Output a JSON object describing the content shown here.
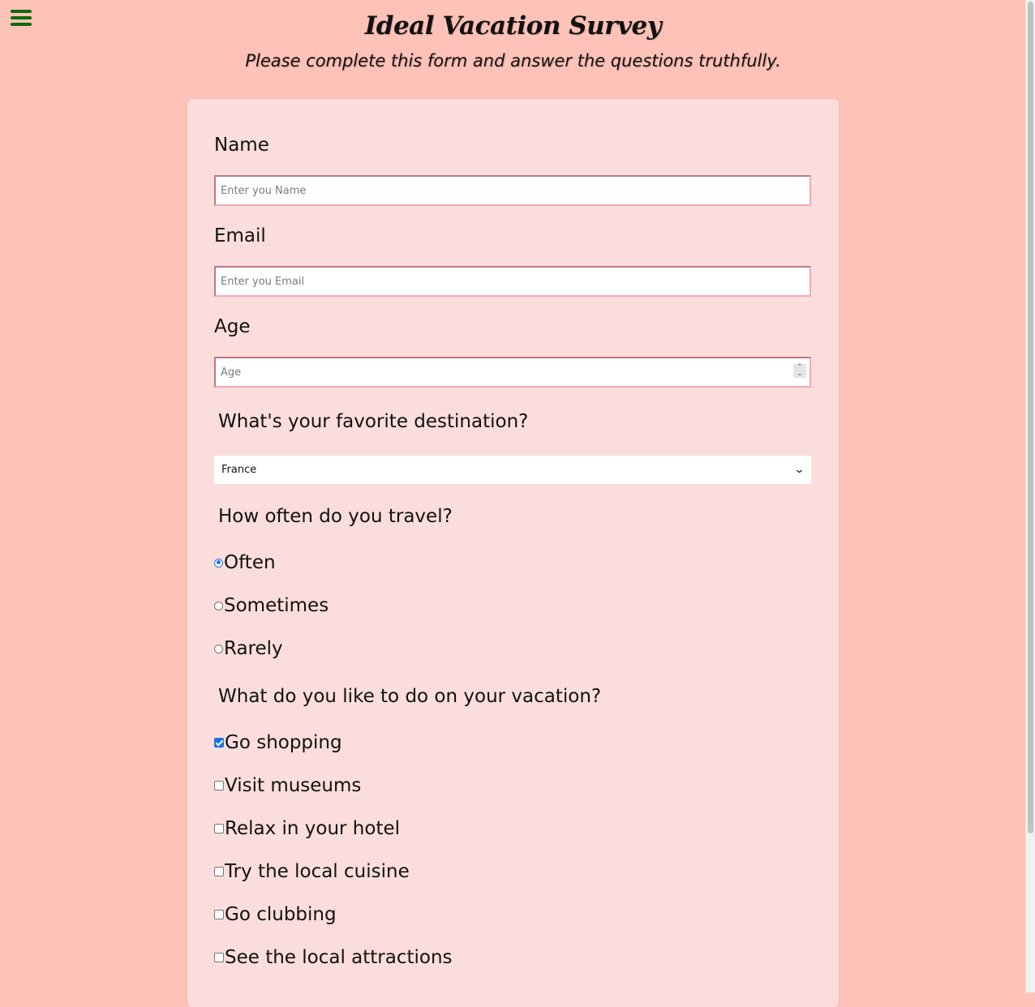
{
  "header": {
    "menu_icon": "hamburger-menu-icon",
    "title": "Ideal Vacation Survey",
    "subtitle": "Please complete this form and answer the questions truthfully."
  },
  "form": {
    "name": {
      "label": "Name",
      "placeholder": "Enter you Name",
      "value": ""
    },
    "email": {
      "label": "Email",
      "placeholder": "Enter you Email",
      "value": ""
    },
    "age": {
      "label": "Age",
      "placeholder": "Age",
      "value": ""
    },
    "destination": {
      "label": "What's your favorite destination?",
      "selected": "France"
    },
    "frequency": {
      "label": "How often do you travel?",
      "options": [
        {
          "label": "Often",
          "checked": true
        },
        {
          "label": "Sometimes",
          "checked": false
        },
        {
          "label": "Rarely",
          "checked": false
        }
      ]
    },
    "activities": {
      "label": "What do you like to do on your vacation?",
      "options": [
        {
          "label": "Go shopping",
          "checked": true
        },
        {
          "label": "Visit museums",
          "checked": false
        },
        {
          "label": "Relax in your hotel",
          "checked": false
        },
        {
          "label": "Try the local cuisine",
          "checked": false
        },
        {
          "label": "Go clubbing",
          "checked": false
        },
        {
          "label": "See the local attractions",
          "checked": false
        }
      ]
    }
  },
  "colors": {
    "page_background": "#ffc2b8",
    "card_background": "#fbdedb",
    "menu_icon": "#0e6b0e",
    "accent": "#1a73e8"
  }
}
